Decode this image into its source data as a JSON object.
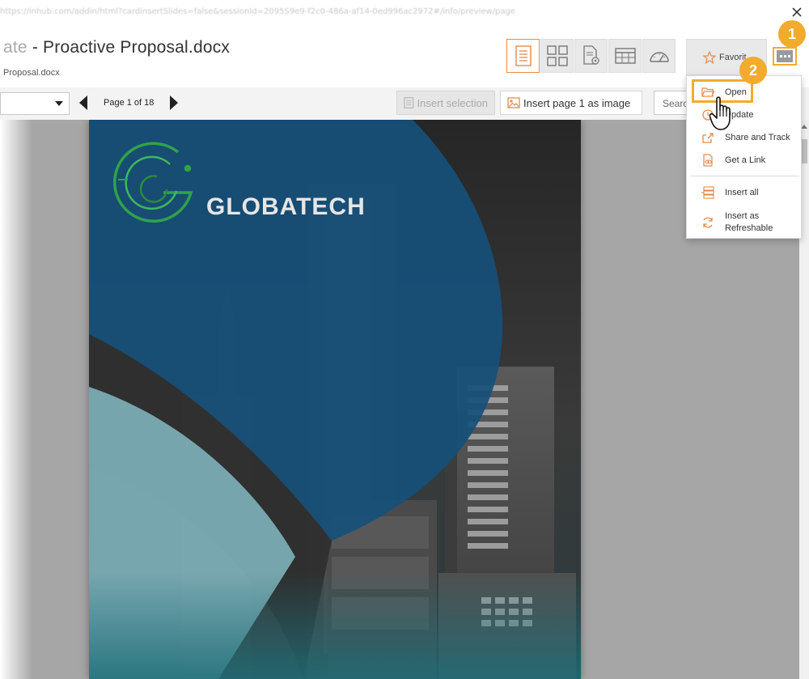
{
  "url_bar": {
    "url": "https://inhub.com/addin/html?cardinsertSlides=false&sessionId=2095S9e9-f2c0-486a-af14-0ed996ac2972#/info/preview/page"
  },
  "header": {
    "title_prefix": "ate",
    "title_main": " - Proactive Proposal.docx",
    "subtitle": "Proposal.docx",
    "favorite_label": "Favorit"
  },
  "toolbar": {
    "page_info": "Page 1 of 18",
    "insert_selection": "Insert selection",
    "insert_page_image": "Insert page 1 as image",
    "search_placeholder": "Search"
  },
  "menu": {
    "items": [
      {
        "label": "Open",
        "icon": "folder-open-icon"
      },
      {
        "label": "Update",
        "icon": "update-icon"
      },
      {
        "label": "Share and Track",
        "icon": "share-icon"
      },
      {
        "label": "Get a Link",
        "icon": "link-doc-icon"
      },
      {
        "label": "Insert all",
        "icon": "insert-all-icon"
      },
      {
        "label": "Insert as Refreshable",
        "icon": "refresh-icon"
      }
    ]
  },
  "document": {
    "brand": "GLOBATECH"
  },
  "callouts": {
    "step1": "1",
    "step2": "2"
  },
  "colors": {
    "accent_orange": "#e68a4a",
    "callout": "#f3ab2e",
    "doc_blue": "#164f7a",
    "doc_teal": "#7fb3bb",
    "logo_green": "#2fa34a"
  }
}
